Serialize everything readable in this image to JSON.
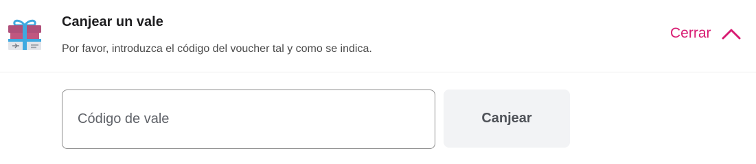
{
  "header": {
    "icon": "gift-voucher-icon",
    "title": "Canjear un vale",
    "subtitle": "Por favor, introduzca el código del voucher tal y como se indica.",
    "close_label": "Cerrar",
    "close_icon": "chevron-up-icon"
  },
  "form": {
    "voucher_input_value": "",
    "voucher_input_placeholder": "Código de vale",
    "redeem_button_label": "Canjear"
  },
  "colors": {
    "accent": "#d81b72",
    "gift_box_pink": "#b0507a",
    "gift_ribbon_blue": "#3fa9e0",
    "button_bg": "#f2f3f5"
  }
}
